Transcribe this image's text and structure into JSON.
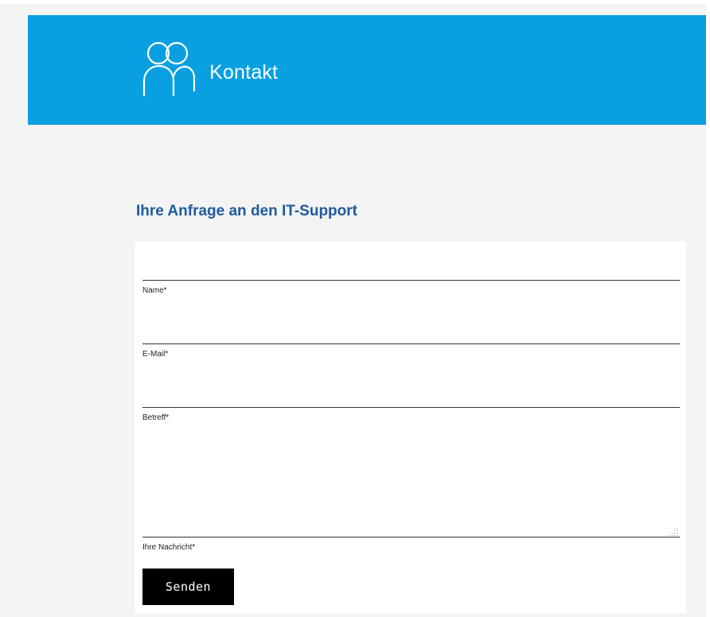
{
  "header": {
    "title": "Kontakt",
    "icon": "people-group-icon",
    "background_color": "#08a0e0"
  },
  "form": {
    "heading": "Ihre Anfrage an den IT-Support",
    "heading_color": "#1f5a9c",
    "fields": {
      "name": {
        "label": "Name*",
        "value": ""
      },
      "email": {
        "label": "E-Mail*",
        "value": ""
      },
      "subject": {
        "label": "Betreff*",
        "value": ""
      },
      "message": {
        "label": "Ihre Nachricht*",
        "value": ""
      }
    },
    "submit_label": "Senden"
  }
}
